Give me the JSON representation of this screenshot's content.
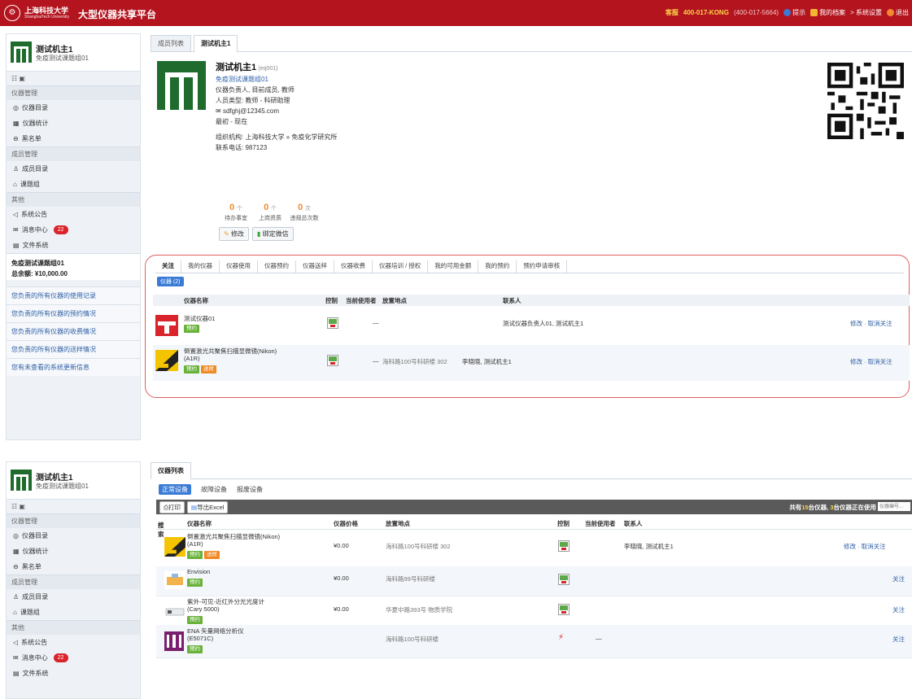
{
  "header": {
    "univ_cn": "上海科技大学",
    "univ_en": "ShanghaiTech University",
    "platform": "大型仪器共享平台",
    "hotline_tag": "客服",
    "hotline": "400-017-KONG",
    "hotline_alt": "(400-017-5664)",
    "help": "提示",
    "my_profile": "我的档案",
    "settings": "> 系统设置",
    "logout": "退出"
  },
  "sidebar": {
    "user_name": "测试机主1",
    "user_group": "免疫测试课题组01",
    "sections": {
      "instrument_mgmt": "仪器管理",
      "member_mgmt": "成员管理",
      "other": "其他"
    },
    "items": {
      "catalog": "仪器目录",
      "stats": "仪器统计",
      "blacklist": "黑名单",
      "members": "成员目录",
      "groups": "课题组",
      "notice": "系统公告",
      "messages": "消息中心",
      "messages_badge": "22",
      "files": "文件系统"
    },
    "group_name": "免疫测试课题组01",
    "group_balance": "总余额: ¥10,000.00",
    "links": [
      "您负责的所有仪器的使用记录",
      "您负责的所有仪器的预约情况",
      "您负责的所有仪器的收费情况",
      "您负责的所有仪器的送样情况",
      "您有未查看的系统更新信息"
    ]
  },
  "page1": {
    "tabs": [
      "成员列表",
      "测试机主1"
    ],
    "profile": {
      "name": "测试机主1",
      "id": "(eq001)",
      "group": "免疫测试课题组01",
      "roles": "仪器负责人, 目前成员, 教师",
      "type": "人员类型: 教师 - 科研助理",
      "email": "sdfghj@12345.com",
      "period": "最初 - 现在",
      "org": "组织机构: 上海科技大学 » 免疫化学研究所",
      "phone": "联系电话: 987123"
    },
    "stats": [
      {
        "num": "0",
        "unit": "个",
        "label": "待办事宜"
      },
      {
        "num": "0",
        "unit": "个",
        "label": "上岗资质"
      },
      {
        "num": "0",
        "unit": "次",
        "label": "违规总次数"
      }
    ],
    "buttons": {
      "edit": "修改",
      "wechat": "绑定微信"
    },
    "follow_tabs": [
      "关注",
      "我的仪器",
      "仪器使用",
      "仪器预约",
      "仪器送样",
      "仪器收费",
      "仪器培训 / 授权",
      "我的可用金额",
      "我的预约",
      "预约申请审核"
    ],
    "follow_filter": "仪器 (2)",
    "columns": [
      "仪器名称",
      "控制",
      "当前使用者",
      "放置地点",
      "联系人"
    ],
    "rows": [
      {
        "name": "测试仪器01",
        "name2": "",
        "tags": [
          "预约"
        ],
        "user": "—",
        "location": "",
        "contact": "测试仪器负责人01, 测试机主1",
        "actions": "修改 · 取消关注"
      },
      {
        "name": "倒置激光共聚焦扫描显微镜(Nikon)",
        "name2": "(A1R)",
        "tags": [
          "预约",
          "送样"
        ],
        "user": "—",
        "location": "海科路100号科研楼 302",
        "contact": "李晓晓, 测试机主1",
        "actions": "修改 · 取消关注"
      }
    ]
  },
  "page2": {
    "tab": "仪器列表",
    "subtabs": [
      "正常设备",
      "故障设备",
      "报废设备"
    ],
    "toolbar": {
      "print": "打印",
      "export": "导出Excel",
      "count_pre": "共有",
      "count_total": "15",
      "count_mid": "台仪器, ",
      "count_using": "3",
      "count_post": "台仪器正在使用",
      "search_placeholder": "仪器编号..."
    },
    "columns": [
      "搜索",
      "仪器名称",
      "仪器价格",
      "放置地点",
      "控制",
      "当前使用者",
      "联系人"
    ],
    "rows": [
      {
        "name": "倒置激光共聚焦扫描显微镜(Nikon)",
        "name2": "(A1R)",
        "tags": [
          "预约",
          "送样"
        ],
        "price": "¥0.00",
        "location": "海科路100号科研楼 302",
        "user": "",
        "contact": "李晓晓, 测试机主1",
        "action": "修改 · 取消关注"
      },
      {
        "name": "Envision",
        "name2": "",
        "tags": [
          "预约"
        ],
        "price": "¥0.00",
        "location": "海科路99号科研楼",
        "user": "",
        "contact": "",
        "action": "关注"
      },
      {
        "name": "紫外-可见-近红外分光光度计",
        "name2": "(Cary 5000)",
        "tags": [
          "预约"
        ],
        "price": "¥0.00",
        "location": "华夏中路393号 物质学院",
        "user": "",
        "contact": "",
        "action": "关注"
      },
      {
        "name": "ENA 矢量网络分析仪",
        "name2": "(E5071C)",
        "tags": [
          "预约"
        ],
        "price": "",
        "location": "海科路100号科研楼",
        "user": "—",
        "contact": "",
        "action": "关注"
      }
    ]
  }
}
